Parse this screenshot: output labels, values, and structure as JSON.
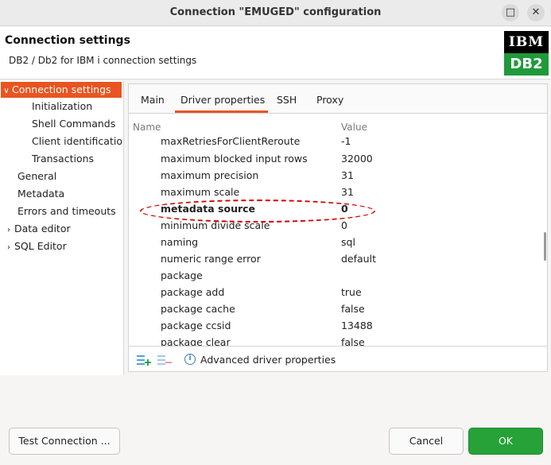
{
  "window": {
    "title": "Connection \"EMUGED\" configuration",
    "minimize_icon": "square-icon",
    "close_icon": "close-icon"
  },
  "header": {
    "title": "Connection settings",
    "subtitle": "DB2 / Db2 for IBM i connection settings",
    "logo_top": "IBM",
    "logo_bottom": "DB2"
  },
  "sidebar": {
    "items": [
      {
        "label": "Connection settings",
        "arrow": "∨"
      },
      {
        "label": "Initialization"
      },
      {
        "label": "Shell Commands"
      },
      {
        "label": "Client identification"
      },
      {
        "label": "Transactions"
      },
      {
        "label": "General"
      },
      {
        "label": "Metadata"
      },
      {
        "label": "Errors and timeouts"
      },
      {
        "label": "Data editor",
        "arrow": "›"
      },
      {
        "label": "SQL Editor",
        "arrow": "›"
      }
    ]
  },
  "tabs": [
    {
      "label": "Main"
    },
    {
      "label": "Driver properties"
    },
    {
      "label": "SSH"
    },
    {
      "label": "Proxy"
    }
  ],
  "table": {
    "col_name": "Name",
    "col_value": "Value",
    "rows": [
      {
        "name": "maxRetriesForClientReroute",
        "value": "-1"
      },
      {
        "name": "maximum blocked input rows",
        "value": "32000"
      },
      {
        "name": "maximum precision",
        "value": "31"
      },
      {
        "name": "maximum scale",
        "value": "31"
      },
      {
        "name": "metadata source",
        "value": "0"
      },
      {
        "name": "minimum divide scale",
        "value": "0"
      },
      {
        "name": "naming",
        "value": "sql"
      },
      {
        "name": "numeric range error",
        "value": "default"
      },
      {
        "name": "package",
        "value": ""
      },
      {
        "name": "package add",
        "value": "true"
      },
      {
        "name": "package cache",
        "value": "false"
      },
      {
        "name": "package ccsid",
        "value": "13488"
      },
      {
        "name": "package clear",
        "value": "false"
      }
    ]
  },
  "footer": {
    "advanced_label": "Advanced driver properties",
    "icons": [
      "add-property-icon",
      "remove-property-icon",
      "info-icon"
    ]
  },
  "buttons": {
    "test": "Test Connection ...",
    "cancel": "Cancel",
    "ok": "OK"
  },
  "colors": {
    "accent": "#e95420",
    "ok": "#26a238",
    "highlight": "#d40000"
  }
}
